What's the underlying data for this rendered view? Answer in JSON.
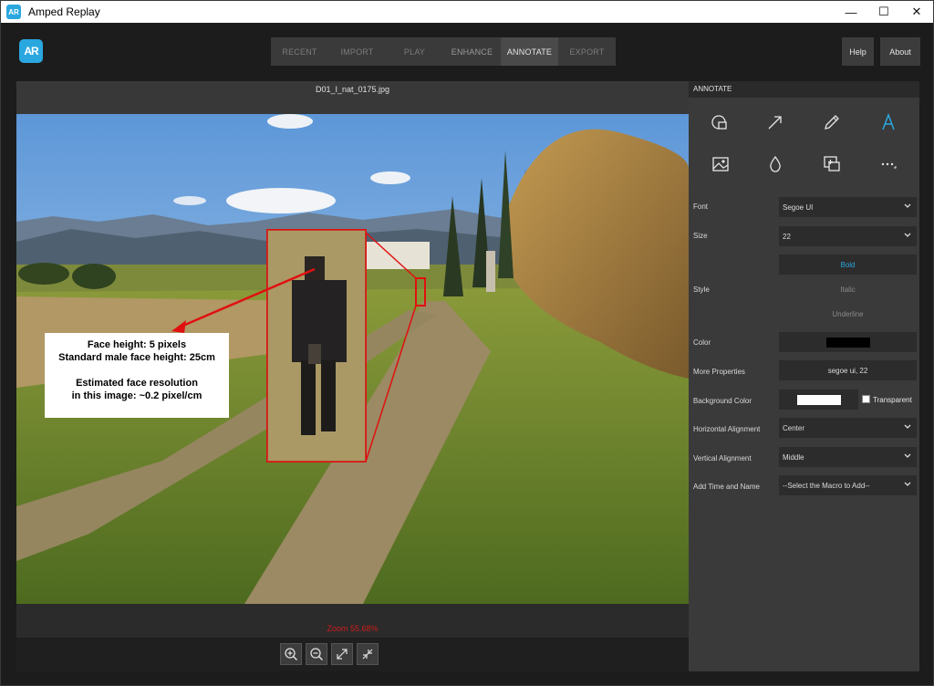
{
  "window": {
    "title": "Amped Replay",
    "app_icon_text": "AR"
  },
  "title_controls": {
    "minimize": "—",
    "maximize": "☐",
    "close": "✕"
  },
  "logo_text": "AR",
  "nav_tabs": [
    {
      "label": "RECENT"
    },
    {
      "label": "IMPORT"
    },
    {
      "label": "PLAY"
    },
    {
      "label": "ENHANCE"
    },
    {
      "label": "ANNOTATE"
    },
    {
      "label": "EXPORT"
    }
  ],
  "top_buttons": {
    "help": "Help",
    "about": "About"
  },
  "viewer": {
    "file_name": "D01_I_nat_0175.jpg",
    "zoom_label": "Zoom 55.68%"
  },
  "callout": {
    "line1": "Face height: 5 pixels",
    "line2": "Standard male face height: 25cm",
    "line3": "Estimated face resolution",
    "line4": "in this image: ~0.2 pixel/cm"
  },
  "annotate": {
    "header": "ANNOTATE",
    "tools": [
      "shape-icon",
      "arrow-icon",
      "pencil-icon",
      "text-icon",
      "image-icon",
      "blur-icon",
      "magnifier-box-icon",
      "more-icon"
    ],
    "accent_color": "#2aa7df",
    "font_label": "Font",
    "font_value": "Segoe UI",
    "size_label": "Size",
    "size_value": "22",
    "style_label": "Style",
    "style_bold": "Bold",
    "style_italic": "Italic",
    "style_underline": "Underline",
    "color_label": "Color",
    "color_value": "#000000",
    "more_label": "More Properties",
    "more_value": "segoe ui, 22",
    "bg_label": "Background Color",
    "bg_value": "#ffffff",
    "transparent_label": "Transparent",
    "halign_label": "Horizontal Alignment",
    "halign_value": "Center",
    "valign_label": "Vertical Alignment",
    "valign_value": "Middle",
    "macro_label": "Add Time and Name",
    "macro_value": "--Select the Macro to Add--"
  }
}
